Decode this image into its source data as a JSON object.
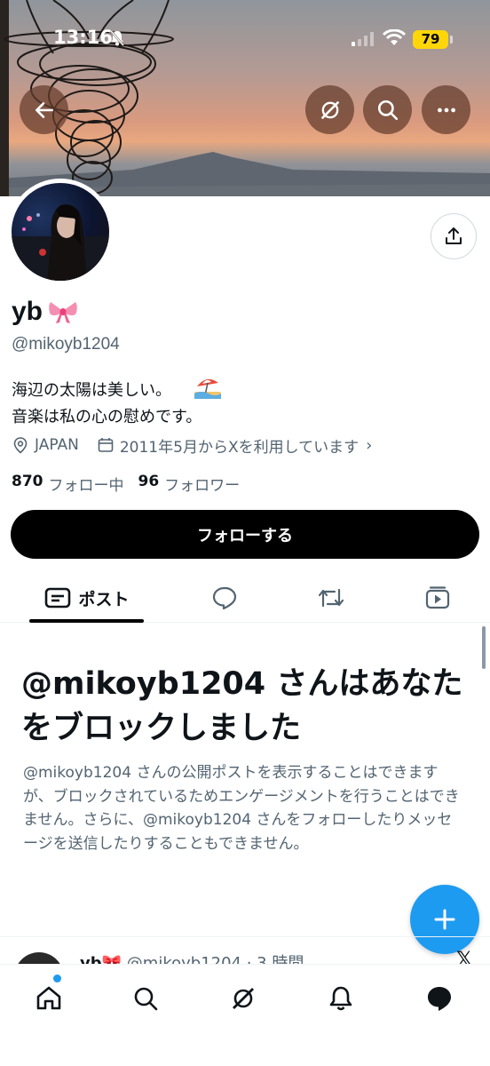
{
  "status_bar": {
    "time": "13:16",
    "battery": "79"
  },
  "profile": {
    "display_name": "yb",
    "handle": "@mikoyb1204",
    "bio_line1": "海辺の太陽は美しい。",
    "bio_line2": "音楽は私の心の慰めです。",
    "location": "JAPAN",
    "joined": "2011年5月からXを利用しています",
    "following_count": "870",
    "following_label": "フォロー中",
    "followers_count": "96",
    "followers_label": "フォロワー",
    "follow_button": "フォローする"
  },
  "tabs": {
    "posts_label": "ポスト"
  },
  "blocked": {
    "title": "@mikoyb1204 さんはあなたをブロックしました",
    "description": "@mikoyb1204 さんの公開ポストを表示することはできますが、ブロックされているためエンゲージメントを行うことはできません。さらに、@mikoyb1204 さんをフォローしたりメッセージを送信したりすることもできません。"
  },
  "post_preview": {
    "name": "yb",
    "meta": "@mikoyb1204 · 3 時間"
  },
  "colors": {
    "accent": "#1d9bf0",
    "text": "#0f1419",
    "secondary": "#536471",
    "battery": "#ffd60a"
  }
}
